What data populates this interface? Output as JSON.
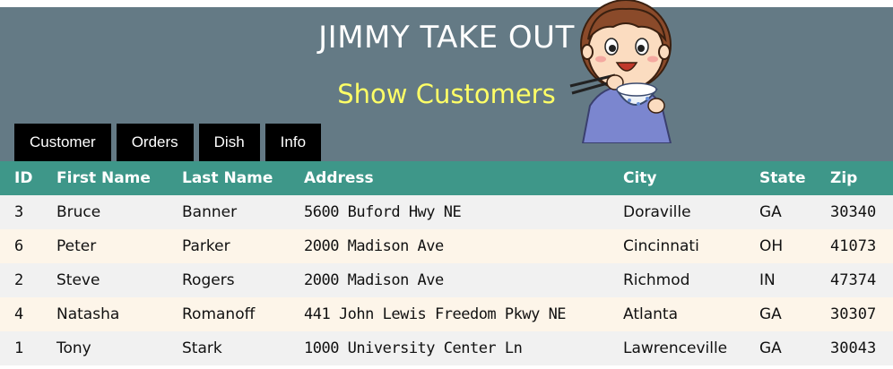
{
  "header": {
    "title": "JIMMY TAKE OUT",
    "subtitle": "Show Customers",
    "background_color": "#647a85",
    "subtitle_color": "#ffff66",
    "mascot_icon": "boy-eating-rice-illustration"
  },
  "nav": [
    {
      "label": "Customer"
    },
    {
      "label": "Orders"
    },
    {
      "label": "Dish"
    },
    {
      "label": "Info"
    }
  ],
  "table": {
    "header_color": "#3e9789",
    "columns": [
      "ID",
      "First Name",
      "Last Name",
      "Address",
      "City",
      "State",
      "Zip"
    ],
    "rows": [
      [
        "3",
        "Bruce",
        "Banner",
        "5600 Buford Hwy NE",
        "Doraville",
        "GA",
        "30340"
      ],
      [
        "6",
        "Peter",
        "Parker",
        "2000 Madison Ave",
        "Cincinnati",
        "OH",
        "41073"
      ],
      [
        "2",
        "Steve",
        "Rogers",
        "2000 Madison Ave",
        "Richmod",
        "IN",
        "47374"
      ],
      [
        "4",
        "Natasha",
        "Romanoff",
        "441 John Lewis Freedom Pkwy NE",
        "Atlanta",
        "GA",
        "30307"
      ],
      [
        "1",
        "Tony",
        "Stark",
        "1000 University Center Ln",
        "Lawrenceville",
        "GA",
        "30043"
      ]
    ]
  }
}
